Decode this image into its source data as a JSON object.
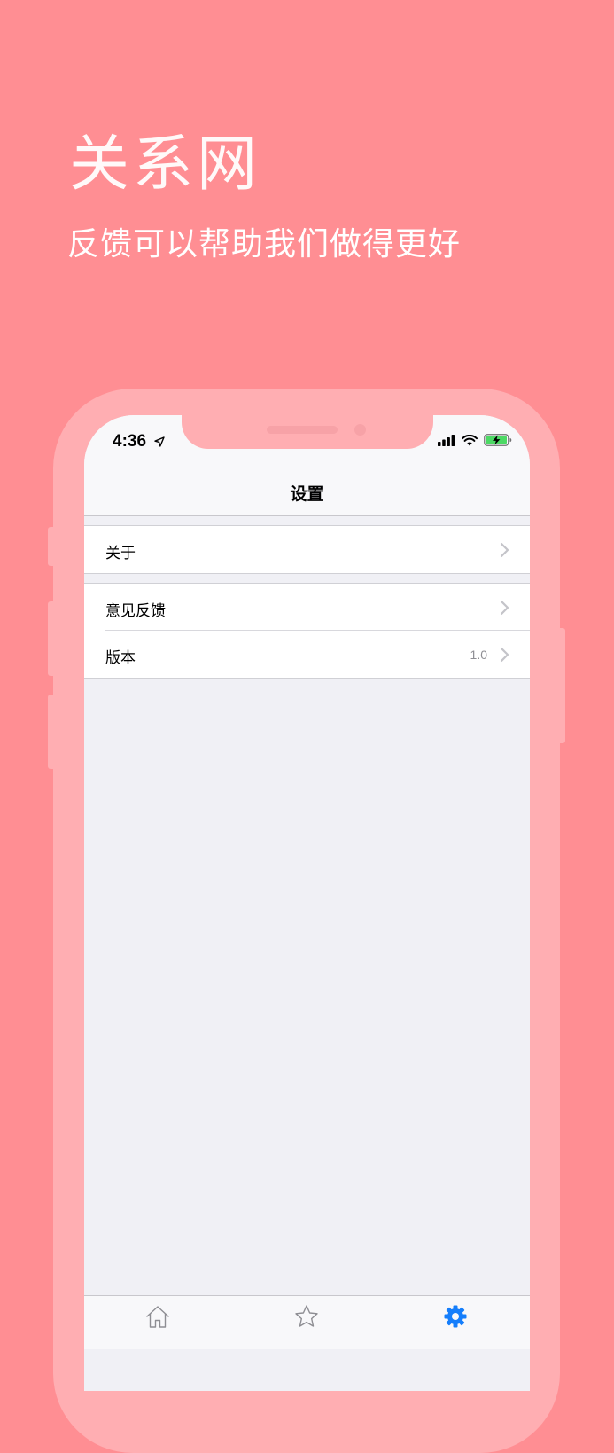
{
  "promo": {
    "title": "关系网",
    "subtitle": "反馈可以帮助我们做得更好"
  },
  "status_bar": {
    "time": "4:36",
    "icons": [
      "location-arrow-icon",
      "signal-icon",
      "wifi-icon",
      "battery-charging-icon"
    ]
  },
  "nav": {
    "title": "设置"
  },
  "settings": {
    "groups": [
      {
        "rows": [
          {
            "label": "关于",
            "value": ""
          }
        ]
      },
      {
        "rows": [
          {
            "label": "意见反馈",
            "value": ""
          },
          {
            "label": "版本",
            "value": "1.0"
          }
        ]
      }
    ]
  },
  "tab_bar": {
    "tabs": [
      {
        "icon": "home-icon",
        "selected": false
      },
      {
        "icon": "star-icon",
        "selected": false
      },
      {
        "icon": "gear-icon",
        "selected": true
      }
    ]
  },
  "colors": {
    "background": "#FF8E93",
    "phone_frame": "#FFAEB2",
    "accent": "#157EFB",
    "battery": "#4CD964"
  }
}
